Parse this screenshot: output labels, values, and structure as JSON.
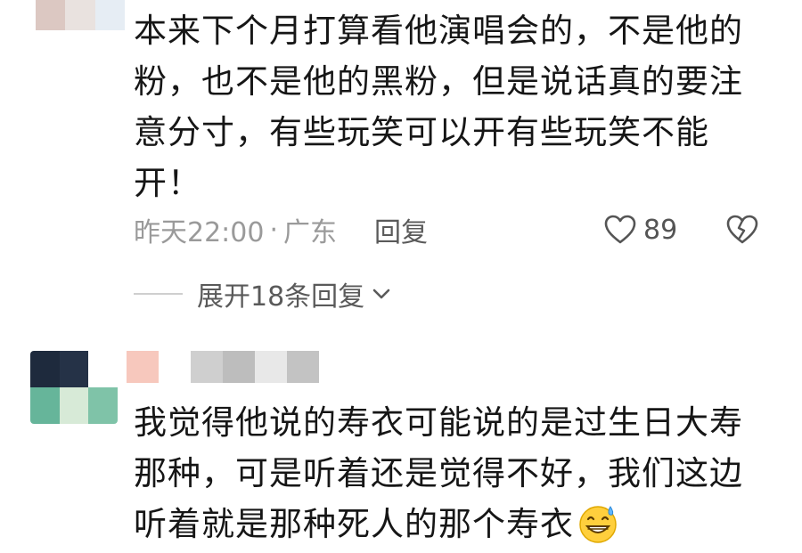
{
  "comment1": {
    "text_lines": [
      "本来下个月打算看他演唱会的，不是他的",
      "粉，也不是他的黑粉，但是说话真的要注",
      "意分寸，有些玩笑可以开有些玩笑不能",
      "开！"
    ],
    "time": "昨天22:00",
    "separator": "·",
    "location": "广东",
    "reply_label": "回复",
    "like_count": "89",
    "like_icon": "heart-outline-icon",
    "dislike_icon": "broken-heart-icon"
  },
  "expand_replies": {
    "label": "展开18条回复",
    "icon": "chevron-down-icon"
  },
  "comment2": {
    "text_lines": [
      "我觉得他说的寿衣可能说的是过生日大寿",
      "那种，可是听着还是觉得不好，我们这边",
      "听着就是那种死人的那个寿衣"
    ],
    "emoji": "sweat-grin-emoji-icon"
  },
  "colors": {
    "meta_gray": "#9a9a9a",
    "action_gray": "#5a5a5a",
    "text": "#161616"
  }
}
